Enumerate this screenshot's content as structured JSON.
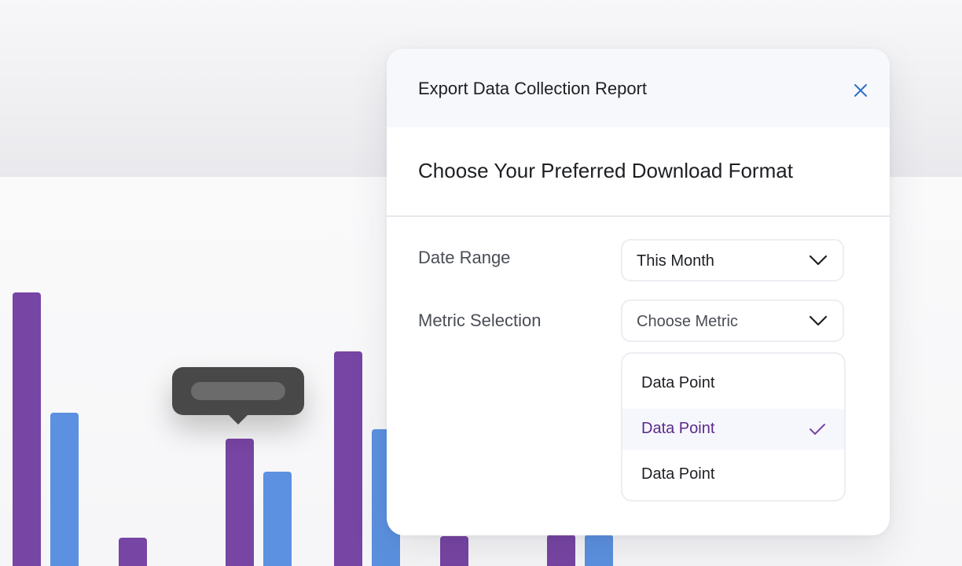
{
  "colors": {
    "purple": "#7745a3",
    "blue": "#5b91e0",
    "accent_blue": "#2f6fc6",
    "selected_text": "#5a2a8a"
  },
  "modal": {
    "title": "Export Data Collection Report",
    "close_icon": "close-icon",
    "heading": "Choose Your Preferred Download Format",
    "fields": {
      "date_range": {
        "label": "Date Range",
        "value": "This Month",
        "icon": "chevron-down-icon"
      },
      "metric": {
        "label": "Metric Selection",
        "placeholder": "Choose Metric",
        "icon": "chevron-down-icon"
      }
    },
    "options": [
      {
        "label": "Data Point",
        "selected": false
      },
      {
        "label": "Data Point",
        "selected": true,
        "icon": "check-icon"
      },
      {
        "label": "Data Point",
        "selected": false
      }
    ]
  },
  "chart_data": {
    "type": "bar",
    "series": [
      {
        "values": [
          348,
          36,
          162,
          273,
          38,
          40
        ]
      },
      {
        "values": [
          195,
          null,
          120,
          174,
          null,
          40
        ]
      }
    ],
    "ylim": [
      0,
      400
    ]
  }
}
